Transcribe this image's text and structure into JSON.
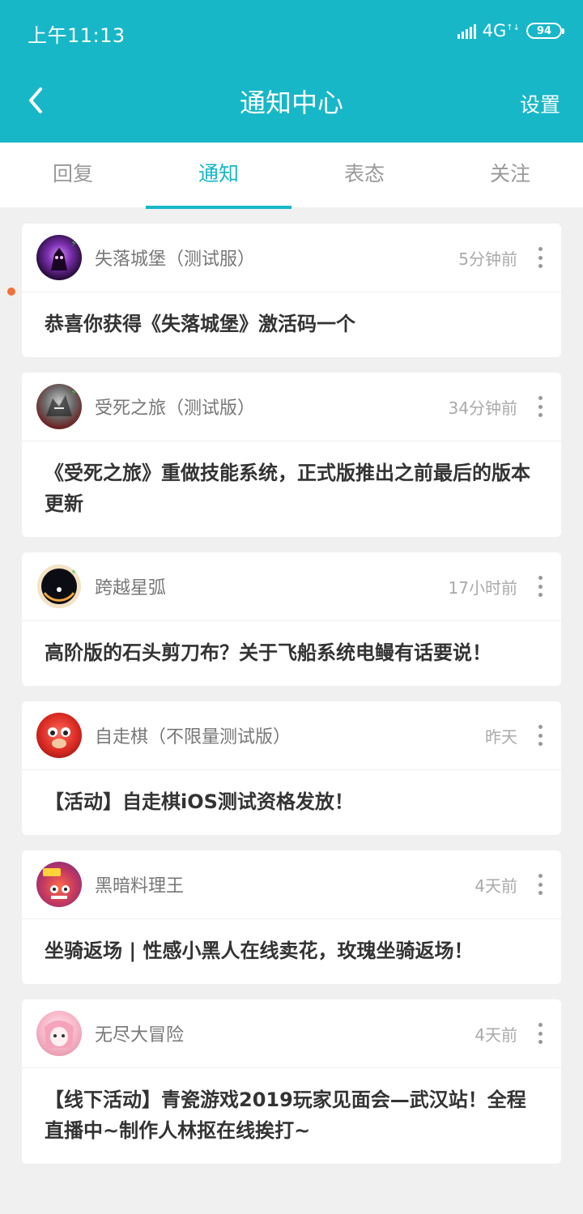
{
  "status_bar": {
    "time": "上午11:13",
    "network": "4G",
    "battery": "94"
  },
  "header": {
    "title": "通知中心",
    "settings_label": "设置"
  },
  "tabs": [
    {
      "label": "回复"
    },
    {
      "label": "通知"
    },
    {
      "label": "表态"
    },
    {
      "label": "关注"
    }
  ],
  "active_tab": "通知",
  "notifications": [
    {
      "source": "失落城堡（测试服）",
      "time": "5分钟前",
      "text": "恭喜你获得《失落城堡》激活码一个",
      "unread": true
    },
    {
      "source": "受死之旅（测试版）",
      "time": "34分钟前",
      "text": "《受死之旅》重做技能系统，正式版推出之前最后的版本更新"
    },
    {
      "source": "跨越星弧",
      "time": "17小时前",
      "text": "高阶版的石头剪刀布？关于飞船系统电鳗有话要说！"
    },
    {
      "source": "自走棋（不限量测试版）",
      "time": "昨天",
      "text": "【活动】自走棋iOS测试资格发放！"
    },
    {
      "source": "黑暗料理王",
      "time": "4天前",
      "text": "坐骑返场 | 性感小黑人在线卖花，玫瑰坐骑返场！"
    },
    {
      "source": "无尽大冒险",
      "time": "4天前",
      "text": "【线下活动】青瓷游戏2019玩家见面会—武汉站！全程直播中~制作人林抠在线挨打~"
    }
  ],
  "colors": {
    "accent": "#17b7c8",
    "unread_dot": "#f0703a"
  }
}
